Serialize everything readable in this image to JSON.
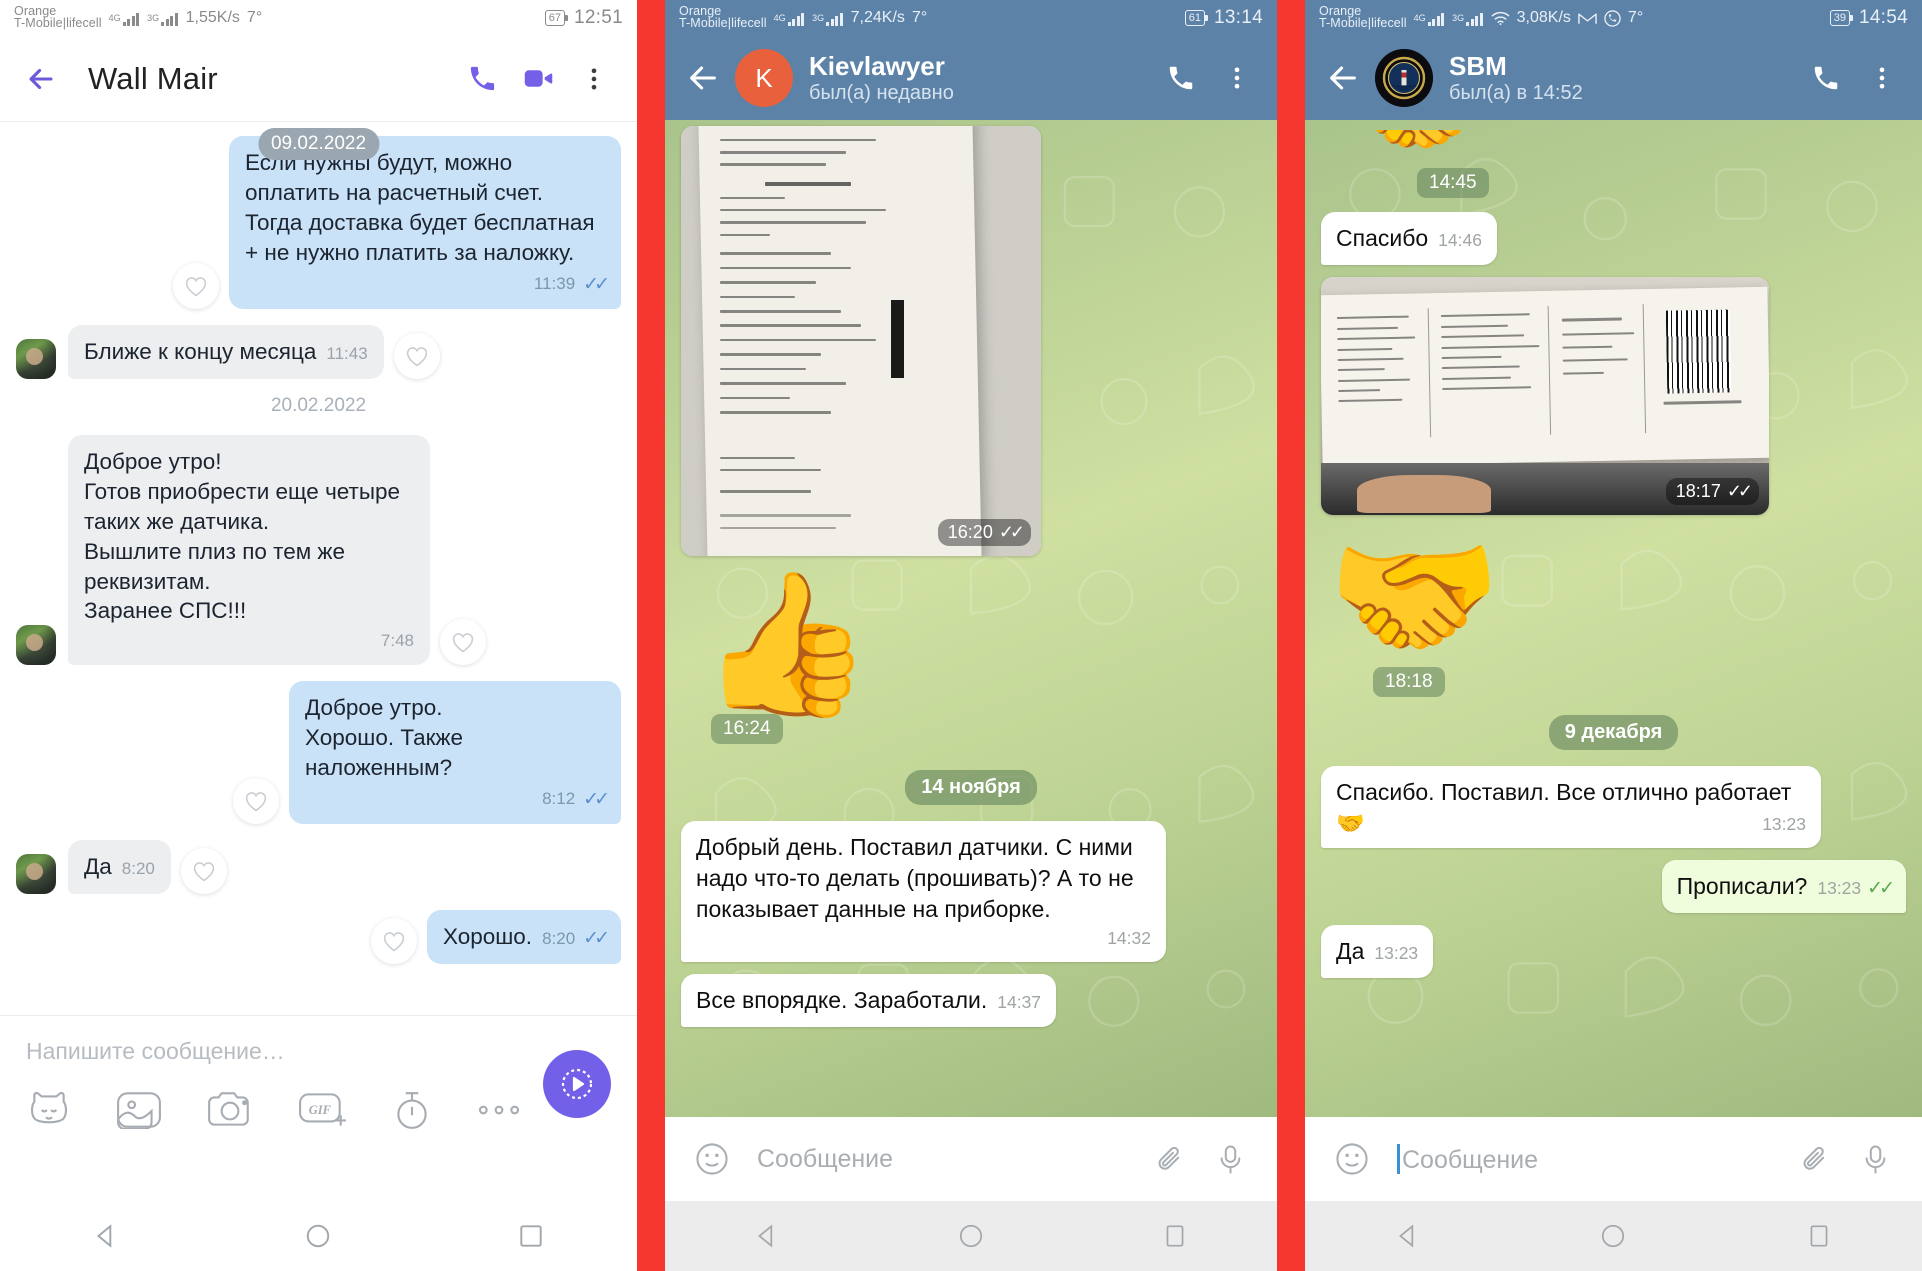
{
  "panels": [
    {
      "app": "viber",
      "status": {
        "carrier_line1": "Orange",
        "carrier_line2": "T-Mobile|lifecell",
        "net1": "4G",
        "net2": "3G",
        "speed": "1,55K/s",
        "temp": "7°",
        "battery": "67",
        "clock": "12:51"
      },
      "header": {
        "title": "Wall Mair",
        "call_icon": "phone-icon",
        "video_icon": "video-camera-icon",
        "menu_icon": "overflow-menu-icon",
        "back_icon": "back-arrow-icon"
      },
      "float_date": "09.02.2022",
      "messages": [
        {
          "dir": "out",
          "text": "Если нужны будут, можно оплатить на расчетный счет. Тогда доставка будет бесплатная + не нужно платить за наложку.",
          "time": "11:39",
          "read": true,
          "reaction": true
        },
        {
          "dir": "in",
          "text": "Ближе к концу месяца",
          "time": "11:43",
          "inline": true,
          "reaction": true
        },
        {
          "dir": "date",
          "text": "20.02.2022"
        },
        {
          "dir": "in",
          "text": "Доброе утро!\nГотов приобрести еще четыре таких же датчика.\nВышлите плиз по тем же реквизитам.\nЗаранее СПС!!!",
          "time": "7:48",
          "reaction": true
        },
        {
          "dir": "out",
          "text": "Доброе утро.\nХорошо. Также наложенным?",
          "time": "8:12",
          "read": true,
          "reaction": true
        },
        {
          "dir": "in",
          "text": "Да",
          "time": "8:20",
          "inline": true,
          "reaction": true
        },
        {
          "dir": "out",
          "text": "Хорошо.",
          "time": "8:20",
          "read": true,
          "inline": true,
          "reaction": true
        }
      ],
      "composer": {
        "placeholder": "Напишите сообщение…",
        "icons": [
          "sticker-icon",
          "gallery-icon",
          "camera-icon",
          "gif-icon",
          "timer-icon",
          "more-icon"
        ],
        "send_icon": "send-icon"
      },
      "nav": [
        "back-nav-icon",
        "home-nav-icon",
        "recents-nav-icon"
      ]
    },
    {
      "app": "telegram",
      "status": {
        "carrier_line1": "Orange",
        "carrier_line2": "T-Mobile|lifecell",
        "net1": "4G",
        "net2": "3G",
        "speed": "7,24K/s",
        "temp": "7°",
        "battery": "61",
        "clock": "13:14"
      },
      "header": {
        "title": "Kievlawyer",
        "subtitle": "был(а) недавно",
        "avatar_letter": "K",
        "avatar_color": "#e8603c",
        "call_icon": "phone-icon",
        "menu_icon": "overflow-menu-icon",
        "back_icon": "back-arrow-icon"
      },
      "messages": [
        {
          "type": "photo",
          "caption_time": "16:20",
          "read": true,
          "alt": "receipt-photo"
        },
        {
          "type": "sticker",
          "glyph": "👍",
          "time": "16:24"
        },
        {
          "type": "date",
          "text": "14 ноября"
        },
        {
          "type": "text",
          "dir": "in",
          "text": "Добрый день. Поставил датчики. С ними надо что-то делать (прошивать)? А то не показывает данные на приборке.",
          "time": "14:32"
        },
        {
          "type": "text",
          "dir": "in",
          "text": "Все впорядке. Заработали.",
          "time": "14:37",
          "inline": true
        }
      ],
      "composer": {
        "placeholder": "Сообщение",
        "emoji_icon": "emoji-icon",
        "attach_icon": "paperclip-icon",
        "mic_icon": "microphone-icon",
        "caret": false
      },
      "nav": [
        "back-nav-icon",
        "home-nav-icon",
        "recents-nav-icon"
      ]
    },
    {
      "app": "telegram",
      "status": {
        "carrier_line1": "Orange",
        "carrier_line2": "T-Mobile|lifecell",
        "net1": "4G",
        "net2": "3G",
        "wifi": "wifi-icon",
        "speed": "3,08K/s",
        "gmail": "gmail-icon",
        "viber": "viber-icon",
        "temp": "7°",
        "battery": "39",
        "clock": "14:54"
      },
      "header": {
        "title": "SBM",
        "subtitle": "был(а) в 14:52",
        "avatar_letter": "",
        "avatar_color": "#0d0d12",
        "call_icon": "phone-icon",
        "menu_icon": "overflow-menu-icon",
        "back_icon": "back-arrow-icon"
      },
      "messages": [
        {
          "type": "sticker_top",
          "glyph": "🤝",
          "time": "14:45"
        },
        {
          "type": "text",
          "dir": "in",
          "text": "Спасибо",
          "time": "14:46",
          "inline": true
        },
        {
          "type": "photo",
          "caption_time": "18:17",
          "read": true,
          "alt": "shipping-label-photo"
        },
        {
          "type": "sticker",
          "glyph": "🤝",
          "time": "18:18"
        },
        {
          "type": "date",
          "text": "9 декабря"
        },
        {
          "type": "text",
          "dir": "in",
          "text": "Спасибо. Поставил. Все отлично работает 🤝",
          "time": "13:23"
        },
        {
          "type": "text",
          "dir": "out",
          "text": "Прописали?",
          "time": "13:23",
          "inline": true,
          "read": true
        },
        {
          "type": "text",
          "dir": "in",
          "text": "Да",
          "time": "13:23",
          "inline": true
        }
      ],
      "composer": {
        "placeholder": "Сообщение",
        "emoji_icon": "emoji-icon",
        "attach_icon": "paperclip-icon",
        "mic_icon": "microphone-icon",
        "caret": true
      },
      "nav": [
        "back-nav-icon",
        "home-nav-icon",
        "recents-nav-icon"
      ]
    }
  ],
  "colors": {
    "viber_accent": "#7360e8",
    "telegram_header": "#5d82a8",
    "separator": "#f5372f"
  }
}
